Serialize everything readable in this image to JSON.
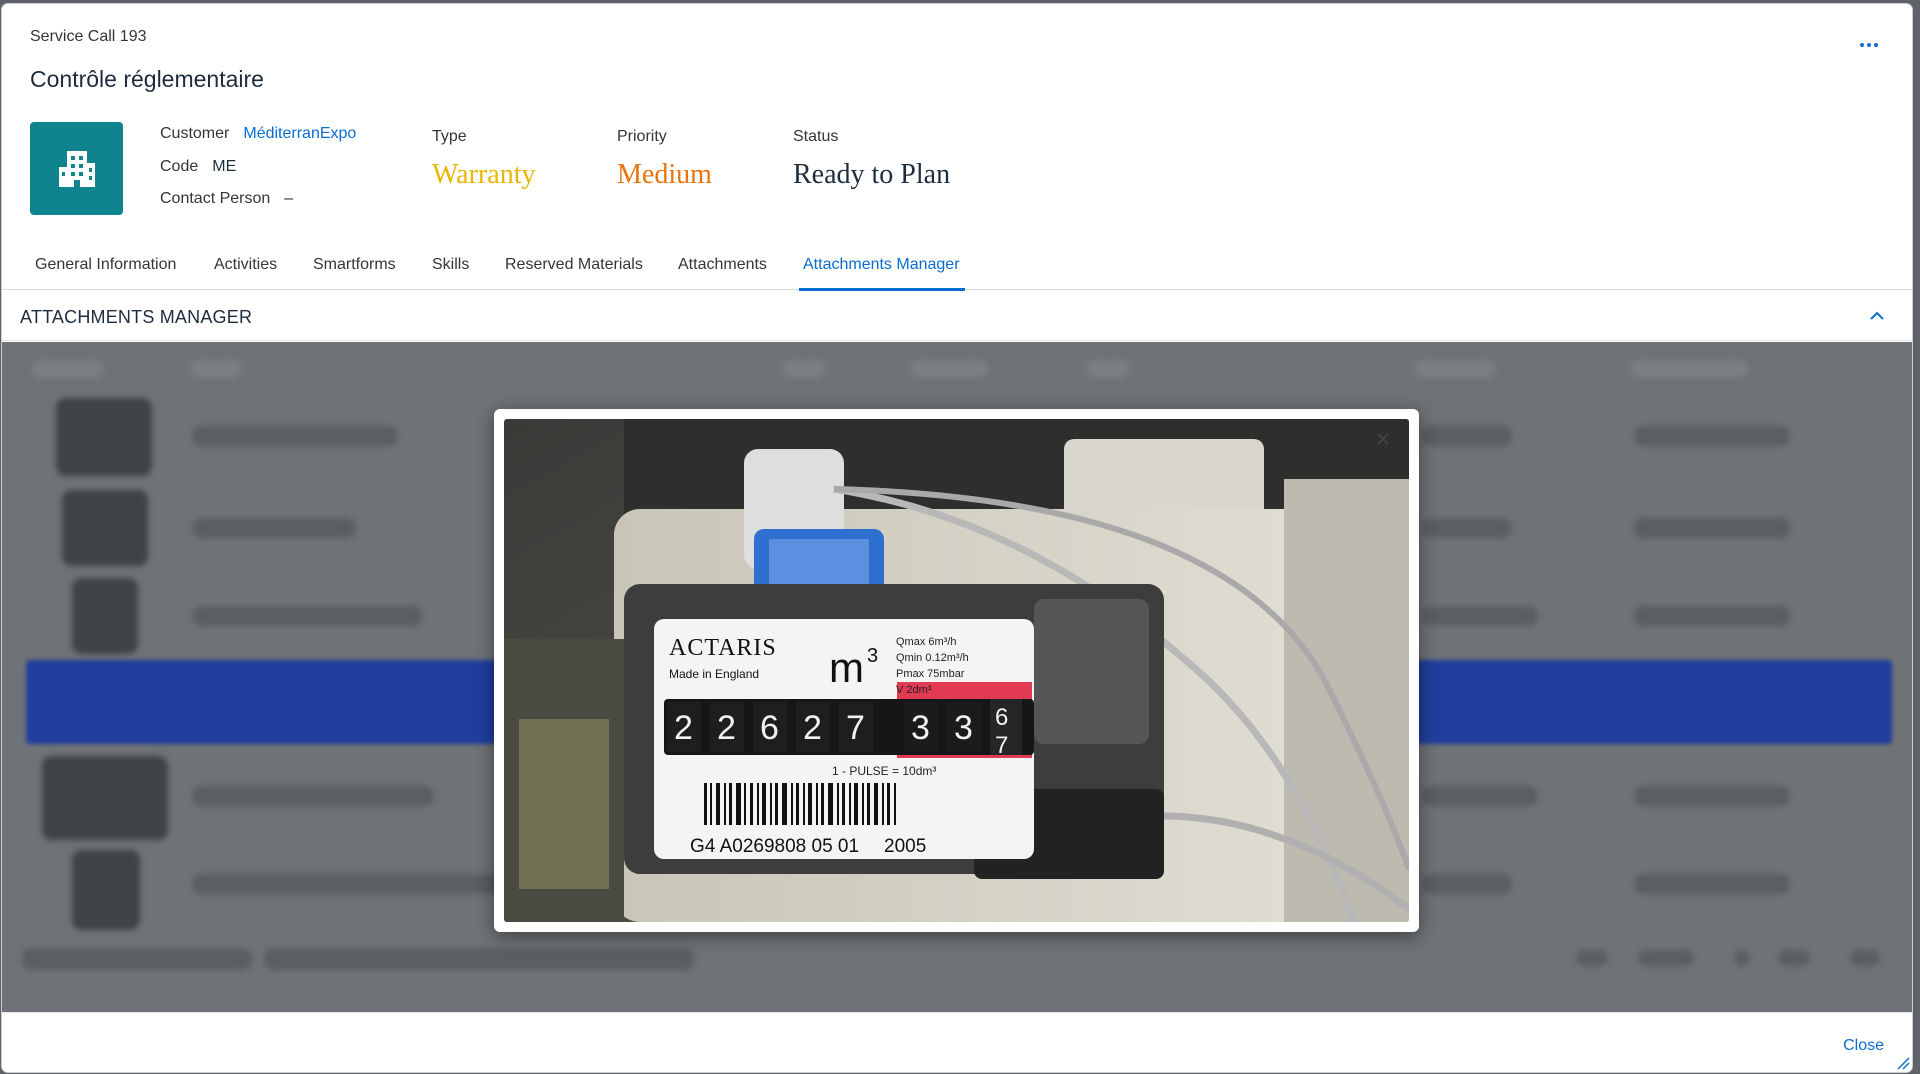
{
  "header": {
    "pre_title": "Service Call 193",
    "title": "Contrôle réglementaire",
    "customer_label": "Customer",
    "customer_value": "MéditerranExpo",
    "code_label": "Code",
    "code_value": "ME",
    "contact_label": "Contact Person",
    "contact_value": "–",
    "type_label": "Type",
    "type_value": "Warranty",
    "priority_label": "Priority",
    "priority_value": "Medium",
    "status_label": "Status",
    "status_value": "Ready to Plan",
    "type_color": "#e9b601",
    "priority_color": "#e9730c",
    "status_color": "#1d2d3e"
  },
  "tabs": [
    {
      "label": "General Information"
    },
    {
      "label": "Activities"
    },
    {
      "label": "Smartforms"
    },
    {
      "label": "Skills"
    },
    {
      "label": "Reserved Materials"
    },
    {
      "label": "Attachments"
    },
    {
      "label": "Attachments Manager",
      "active": true
    }
  ],
  "section": {
    "title": "ATTACHMENTS MANAGER"
  },
  "photo": {
    "brand": "ACTARIS",
    "made_in": "Made in England",
    "unit": "m",
    "unit_exp": "3",
    "specs": [
      "Qmax 6m³/h",
      "Qmin 0.12m³/h",
      "Pmax 75mbar",
      "V 2dm³"
    ],
    "digits_black": [
      "2",
      "2",
      "6",
      "2",
      "7"
    ],
    "digits_red": [
      "3",
      "3"
    ],
    "last_digit_top": "6",
    "last_digit_bottom": "7",
    "pulse": "1 - PULSE = 10dm³",
    "serial": "G4 A0269808 05 01",
    "year": "2005"
  },
  "footer": {
    "close_label": "Close"
  },
  "colors": {
    "accent": "#0a6ed1",
    "avatar_bg": "#10848e"
  }
}
